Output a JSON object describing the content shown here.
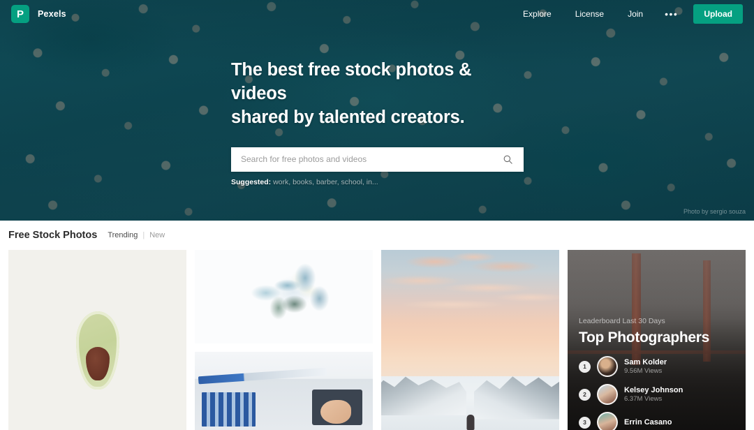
{
  "nav": {
    "logo_letter": "P",
    "brand": "Pexels",
    "links": [
      {
        "label": "Explore"
      },
      {
        "label": "License"
      },
      {
        "label": "Join"
      }
    ],
    "more_dots": "•••",
    "upload_label": "Upload"
  },
  "hero": {
    "title_line1": "The best free stock photos & videos",
    "title_line2": "shared by talented creators.",
    "search_placeholder": "Search for free photos and videos",
    "search_value": "",
    "suggested_label": "Suggested:",
    "suggested_terms": "work, books, barber, school, in...",
    "credit": "Photo by sergio souza"
  },
  "section": {
    "title": "Free Stock Photos",
    "tabs": [
      {
        "label": "Trending",
        "active": true
      },
      {
        "label": "New",
        "active": false
      }
    ],
    "tab_separator": "|"
  },
  "leaderboard": {
    "kicker": "Leaderboard Last 30 Days",
    "heading": "Top Photographers",
    "entries": [
      {
        "rank": "1",
        "name": "Sam Kolder",
        "views": "9.56M Views"
      },
      {
        "rank": "2",
        "name": "Kelsey Johnson",
        "views": "6.37M Views"
      },
      {
        "rank": "3",
        "name": "Errin Casano",
        "views": ""
      }
    ]
  },
  "colors": {
    "accent_green": "#05a081",
    "hero_teal": "#14525c",
    "text_dark": "#2b2b2b",
    "text_muted": "#9a9a9a"
  }
}
